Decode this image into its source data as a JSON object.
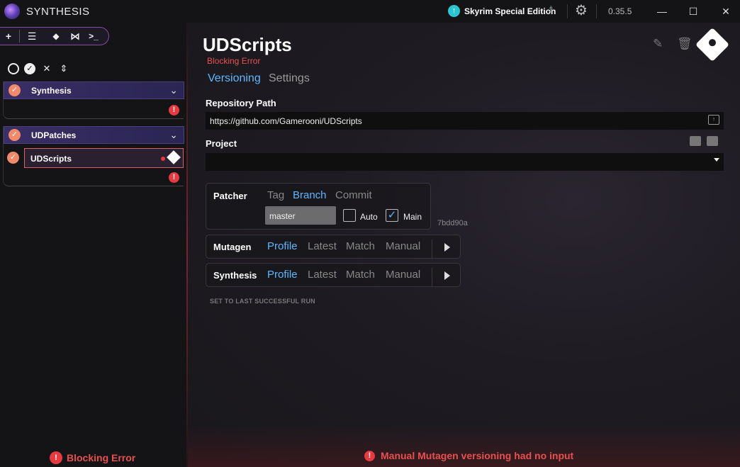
{
  "window": {
    "app_title": "SYNTHESIS",
    "game_name": "Skyrim Special Edition",
    "version": "0.35.5",
    "icons": [
      "app-logo-icon",
      "game-update-icon",
      "gear-icon",
      "minimize-icon",
      "maximize-icon",
      "close-icon"
    ]
  },
  "toolbar": {
    "buttons": [
      {
        "name": "add-icon",
        "glyph": "+"
      },
      {
        "name": "group-icon",
        "glyph": "☰"
      },
      {
        "name": "git-icon",
        "glyph": "◆"
      },
      {
        "name": "visual-studio-icon",
        "glyph": "⋈"
      },
      {
        "name": "terminal-icon",
        "glyph": ">_"
      }
    ]
  },
  "sidebar": {
    "groups": [
      {
        "name": "Synthesis",
        "has_error": true,
        "patchers": []
      },
      {
        "name": "UDPatches",
        "has_error": true,
        "patchers": [
          {
            "name": "UDScripts",
            "selected": true,
            "has_error": true
          }
        ]
      }
    ],
    "bottom_error": "Blocking Error"
  },
  "main": {
    "title": "UDScripts",
    "status": "Blocking Error",
    "tabs": [
      {
        "label": "Versioning",
        "active": true
      },
      {
        "label": "Settings",
        "active": false
      }
    ],
    "repository_label": "Repository Path",
    "repository_value": "https://github.com/Gamerooni/UDScripts",
    "project_label": "Project",
    "project_value": "",
    "patcher": {
      "title": "Patcher",
      "options": [
        "Tag",
        "Branch",
        "Commit"
      ],
      "selected": "Branch",
      "branch_value": "master",
      "auto_label": "Auto",
      "auto_checked": false,
      "main_label": "Main",
      "main_checked": true,
      "commit_hash": "7bdd90a"
    },
    "mutagen": {
      "title": "Mutagen",
      "options": [
        "Profile",
        "Latest",
        "Match",
        "Manual"
      ],
      "selected": "Profile"
    },
    "synthesis": {
      "title": "Synthesis",
      "options": [
        "Profile",
        "Latest",
        "Match",
        "Manual"
      ],
      "selected": "Profile"
    },
    "set_last": "SET TO LAST SUCCESSFUL RUN",
    "status_message": "Manual Mutagen versioning had no input"
  },
  "colors": {
    "accent": "#5fb7ff",
    "error": "#e53a40",
    "check": "#f08a6a",
    "group_header": "#3a2e66"
  }
}
